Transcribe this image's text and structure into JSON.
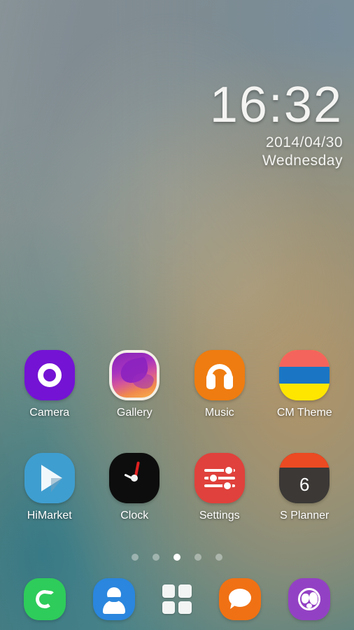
{
  "wallpaper": {
    "description": "blurred abstract gradient",
    "colors": {
      "top_left_gray_blue": "#7e8a92",
      "top_right_blue": "#788c9c",
      "mid_sage": "#8e9a86",
      "bottom_left_teal": "#2c7887",
      "right_warm_tan": "#b09468"
    }
  },
  "clock_widget": {
    "time": "16:32",
    "date": "2014/04/30",
    "weekday": "Wednesday",
    "text_color": "#f4f4f2"
  },
  "home_rows": [
    {
      "apps": [
        {
          "label": "Camera",
          "icon": "camera-icon",
          "color": "#7413d4"
        },
        {
          "label": "Gallery",
          "icon": "gallery-icon",
          "color": "#a832c0"
        },
        {
          "label": "Music",
          "icon": "music-icon",
          "color": "#ef7c10"
        },
        {
          "label": "CM Theme",
          "icon": "cm-theme-icon",
          "color": "#ffe600"
        }
      ]
    },
    {
      "apps": [
        {
          "label": "HiMarket",
          "icon": "himarket-icon",
          "color": "#3f9ed0"
        },
        {
          "label": "Clock",
          "icon": "clock-icon",
          "color": "#0d0d0d"
        },
        {
          "label": "Settings",
          "icon": "settings-icon",
          "color": "#e0413c"
        },
        {
          "label": "S Planner",
          "icon": "s-planner-icon",
          "color": "#ec4a22"
        }
      ]
    }
  ],
  "s_planner_day": "6",
  "page_indicator": {
    "total": 5,
    "active_index": 2,
    "active_color": "#ffffff",
    "inactive_color": "rgba(235,240,238,0.42)"
  },
  "dock": {
    "items": [
      {
        "name": "Phone",
        "icon": "phone-icon",
        "color": "#2ecc5a"
      },
      {
        "name": "Contacts",
        "icon": "contacts-icon",
        "color": "#2a86de"
      },
      {
        "name": "App drawer",
        "icon": "app-drawer-icon",
        "color": "#f2f5f4"
      },
      {
        "name": "Messaging",
        "icon": "message-icon",
        "color": "#f07114"
      },
      {
        "name": "Browser",
        "icon": "browser-icon",
        "color": "#9341c4"
      }
    ]
  }
}
